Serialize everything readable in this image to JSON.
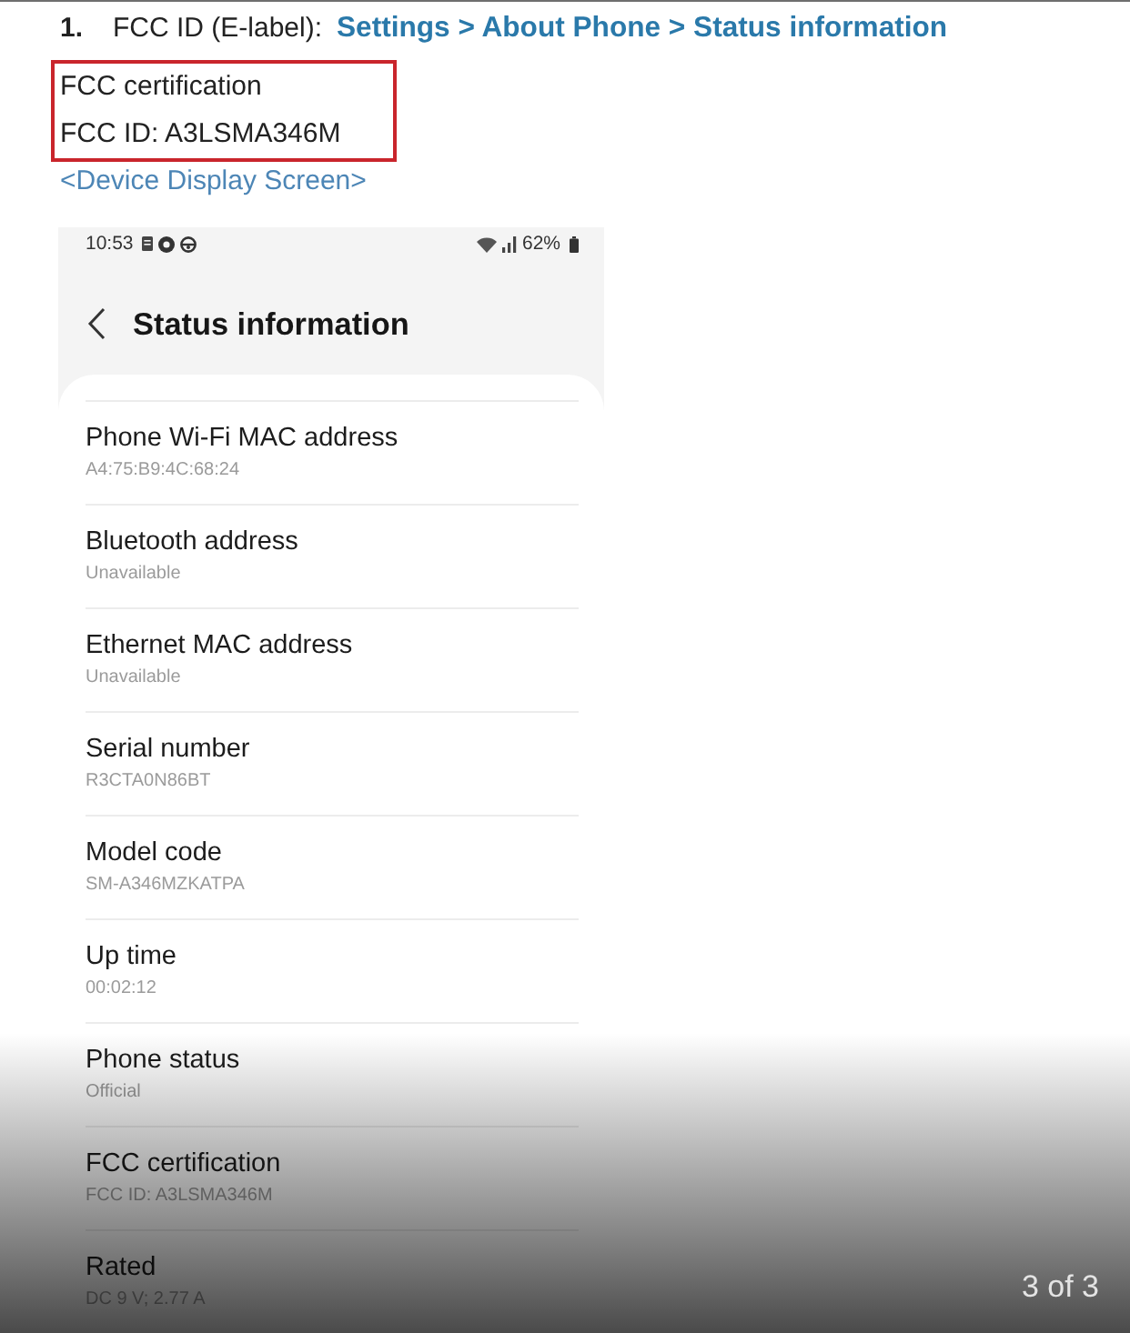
{
  "heading": {
    "number": "1.",
    "label": "FCC ID (E-label):",
    "path": "Settings > About Phone > Status information"
  },
  "highlight_box": {
    "lines": [
      "FCC certification",
      "FCC ID: A3LSMA346M"
    ]
  },
  "caption": "<Device Display Screen>",
  "phone": {
    "status_bar": {
      "time": "10:53",
      "battery": "62%"
    },
    "title": "Status information",
    "items": [
      {
        "label": "Phone Wi-Fi MAC address",
        "value": "A4:75:B9:4C:68:24"
      },
      {
        "label": "Bluetooth address",
        "value": "Unavailable"
      },
      {
        "label": "Ethernet MAC address",
        "value": "Unavailable"
      },
      {
        "label": "Serial number",
        "value": "R3CTA0N86BT"
      },
      {
        "label": "Model code",
        "value": "SM-A346MZKATPA"
      },
      {
        "label": "Up time",
        "value": "00:02:12"
      },
      {
        "label": "Phone status",
        "value": "Official"
      },
      {
        "label": "FCC certification",
        "value": "FCC ID: A3LSMA346M"
      },
      {
        "label": "Rated",
        "value": "DC 9 V; 2.77 A"
      }
    ]
  },
  "pager": "3 of 3"
}
